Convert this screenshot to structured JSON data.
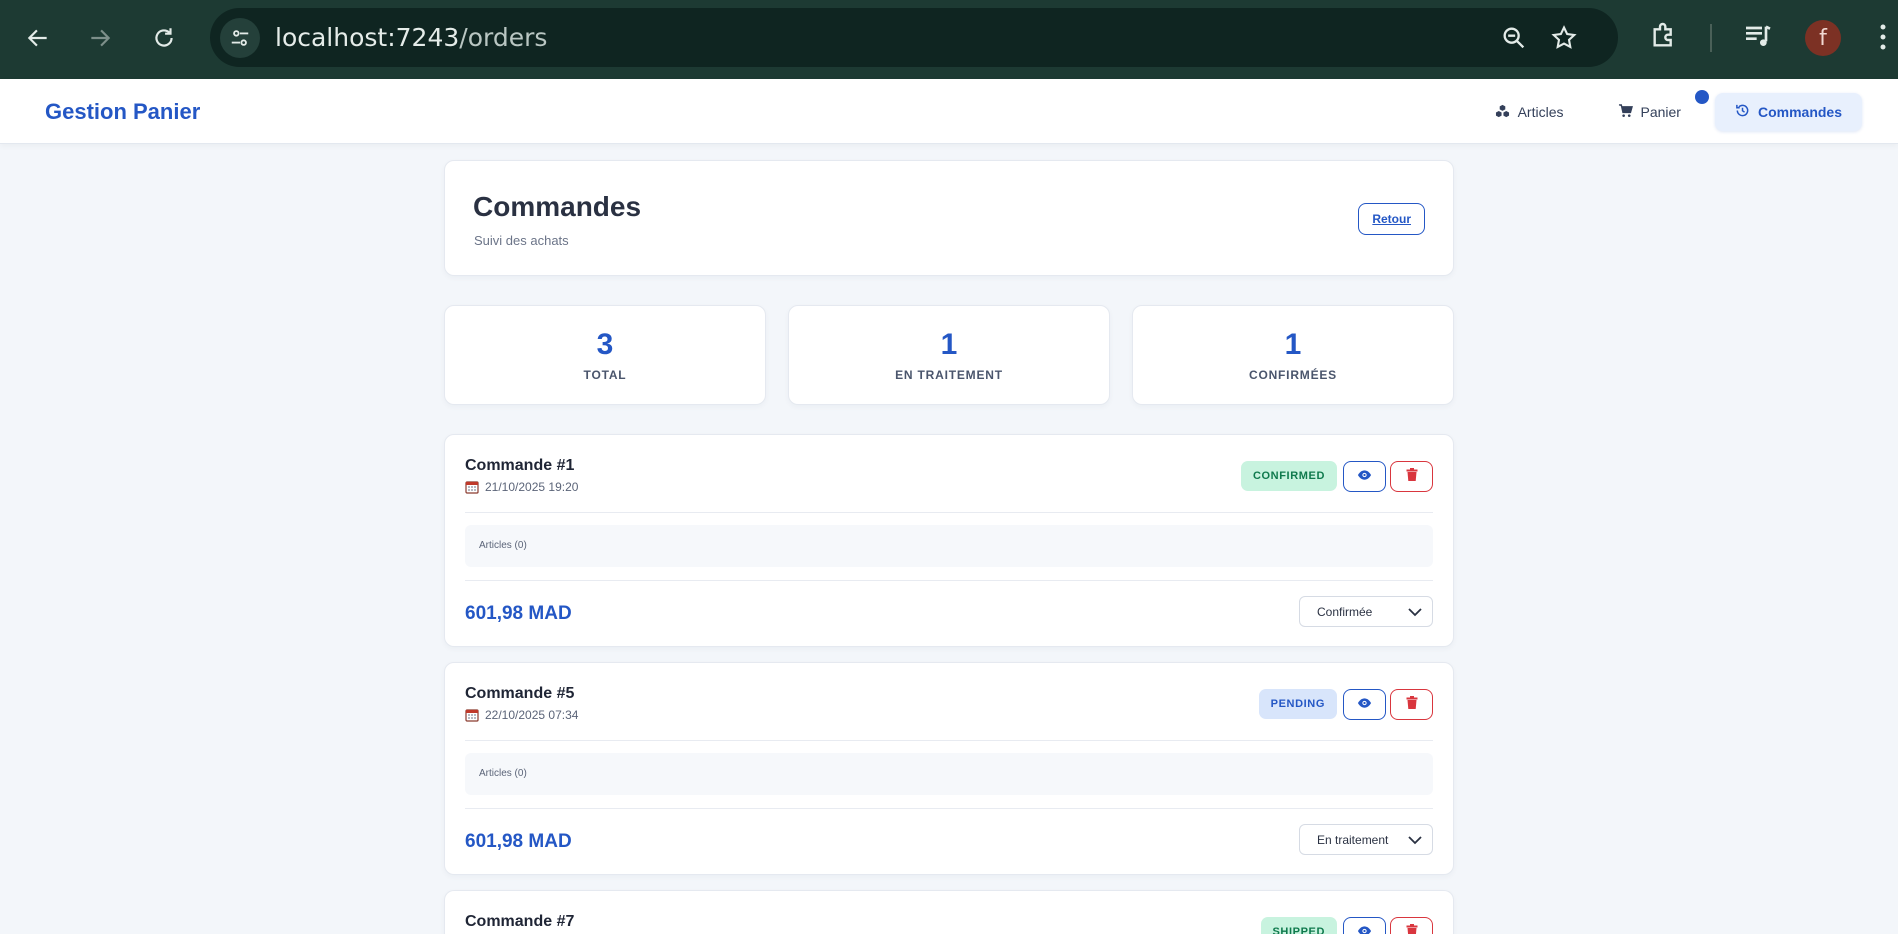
{
  "browser": {
    "url_host": "localhost:7243",
    "url_path": "/orders",
    "avatar_letter": "f"
  },
  "header": {
    "brand": "Gestion Panier",
    "nav": [
      {
        "label": "Articles",
        "icon": "cubes-icon"
      },
      {
        "label": "Panier",
        "icon": "cart-icon"
      },
      {
        "label": "Commandes",
        "icon": "history-icon",
        "active": true
      }
    ]
  },
  "page": {
    "title": "Commandes",
    "subtitle": "Suivi des achats",
    "back_label": "Retour"
  },
  "stats": [
    {
      "value": "3",
      "label": "TOTAL"
    },
    {
      "value": "1",
      "label": "EN TRAITEMENT"
    },
    {
      "value": "1",
      "label": "CONFIRMÉES"
    }
  ],
  "orders": [
    {
      "title": "Commande #1",
      "date": "21/10/2025 19:20",
      "status": "CONFIRMED",
      "items": "Articles (0)",
      "total": "601,98 MAD",
      "status_select": "Confirmée"
    },
    {
      "title": "Commande #5",
      "date": "22/10/2025 07:34",
      "status": "PENDING",
      "items": "Articles (0)",
      "total": "601,98 MAD",
      "status_select": "En traitement"
    },
    {
      "title": "Commande #7",
      "status": "SHIPPED"
    }
  ],
  "colors": {
    "accent": "#2457c5",
    "danger": "#d9363e",
    "success_bg": "#c8f3df",
    "pending_bg": "#d8e5fb",
    "chrome_bg": "#1d3a33"
  }
}
